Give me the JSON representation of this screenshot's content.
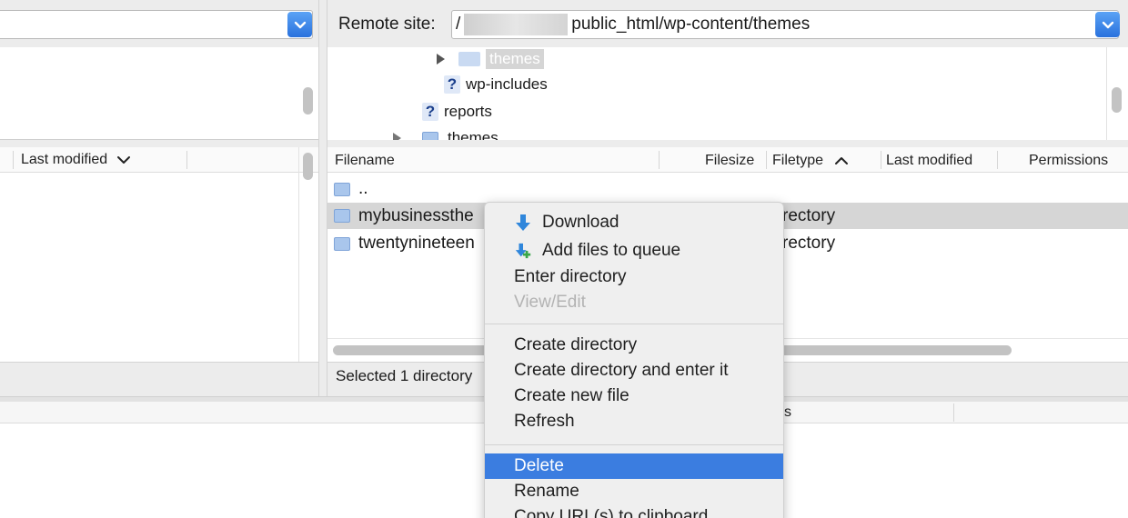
{
  "local_site": {
    "path": "",
    "columns": {
      "last_modified": "Last modified"
    }
  },
  "remote_site": {
    "label": "Remote site:",
    "path_prefix": "/",
    "path": "public_html/wp-content/themes",
    "tree": [
      {
        "label": "themes",
        "state": "selected"
      },
      {
        "label": "wp-includes",
        "state": "unknown"
      },
      {
        "label": "reports",
        "state": "unknown"
      },
      {
        "label": "themes",
        "state": "partial"
      }
    ],
    "columns": {
      "filename": "Filename",
      "filesize": "Filesize",
      "filetype": "Filetype",
      "last_modified": "Last modified",
      "permissions": "Permissions"
    },
    "files": [
      {
        "name": "..",
        "type": ""
      },
      {
        "name": "mybusinessthe",
        "type": "rectory"
      },
      {
        "name": "twentynineteen",
        "type": "rectory"
      }
    ],
    "status": "Selected 1 directory"
  },
  "queue": {
    "col_fragment": "s"
  },
  "context_menu": {
    "items": [
      {
        "label": "Download",
        "icon": "download-arrow-icon"
      },
      {
        "label": "Add files to queue",
        "icon": "add-to-queue-icon"
      },
      {
        "label": "Enter directory"
      },
      {
        "label": "View/Edit",
        "disabled": true
      },
      {
        "label": "Create directory"
      },
      {
        "label": "Create directory and enter it"
      },
      {
        "label": "Create new file"
      },
      {
        "label": "Refresh"
      },
      {
        "label": "Delete",
        "selected": true
      },
      {
        "label": "Rename"
      },
      {
        "label": "Copy URL(s) to clipboard"
      }
    ]
  },
  "colors": {
    "accent": "#3b7de0",
    "combo_button": "#2a72dd",
    "folder": "#a9c6ec"
  }
}
